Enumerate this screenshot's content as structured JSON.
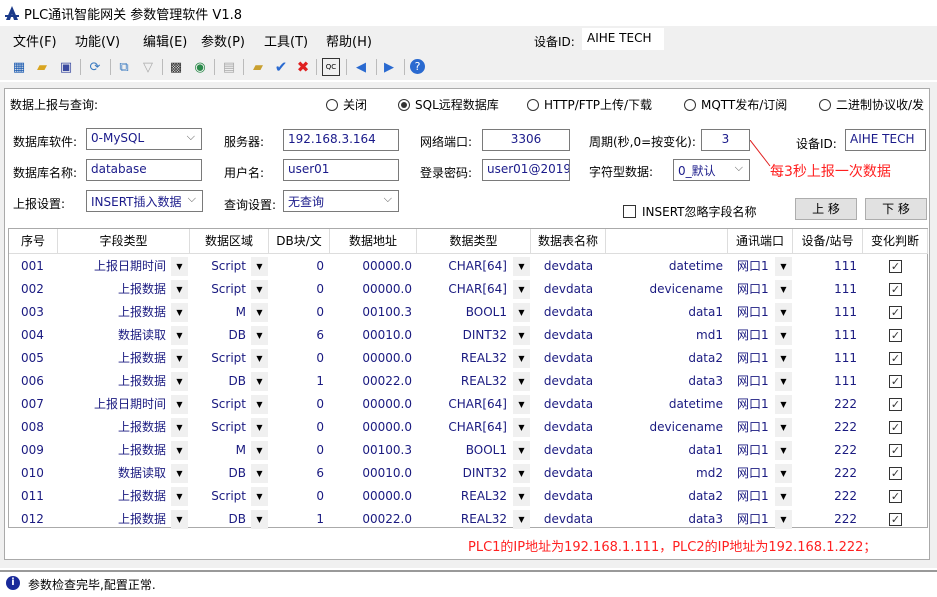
{
  "app": {
    "title": "PLC通讯智能网关 参数管理软件 V1.8"
  },
  "menu": [
    "文件(F)",
    "功能(V)",
    "编辑(E)",
    "参数(P)",
    "工具(T)",
    "帮助(H)"
  ],
  "header_device": {
    "label": "设备ID:",
    "value": "AIHE TECH"
  },
  "toolbar": [
    "network-icon",
    "open-folder-icon",
    "save-icon",
    "refresh-icon",
    "topology-icon",
    "connector-icon",
    "monitor-icon",
    "web-icon",
    "table-icon",
    "import-icon",
    "check-icon",
    "delete-icon",
    "qc-icon",
    "prev-icon",
    "next-icon",
    "help-icon"
  ],
  "report": {
    "label": "数据上报与查询:",
    "options": [
      "关闭",
      "SQL远程数据库",
      "HTTP/FTP上传/下载",
      "MQTT发布/订阅",
      "二进制协议收/发"
    ],
    "selected": 1
  },
  "form": {
    "db_software": {
      "label": "数据库软件:",
      "value": "0-MySQL"
    },
    "server": {
      "label": "服务器:",
      "value": "192.168.3.164"
    },
    "port": {
      "label": "网络端口:",
      "value": "3306"
    },
    "period": {
      "label": "周期(秒,0=按变化):",
      "value": "3"
    },
    "device_id": {
      "label": "设备ID:",
      "value": "AIHE TECH"
    },
    "db_name": {
      "label": "数据库名称:",
      "value": "database"
    },
    "username": {
      "label": "用户名:",
      "value": "user01"
    },
    "password": {
      "label": "登录密码:",
      "value": "user01@2019("
    },
    "string_data": {
      "label": "字符型数据:",
      "value": "0_默认"
    },
    "report_setting": {
      "label": "上报设置:",
      "value": "INSERT插入数据"
    },
    "query_setting": {
      "label": "查询设置:",
      "value": "无查询"
    },
    "insert_ignore": {
      "label": "INSERT忽略字段名称",
      "checked": false
    },
    "move_up": "上 移",
    "move_down": "下 移"
  },
  "annotations": {
    "period_note": "每3秒上报一次数据",
    "ip_note": "PLC1的IP地址为192.168.1.111，PLC2的IP地址为192.168.1.222；",
    "color": "#ff0000"
  },
  "table": {
    "columns": [
      "序号",
      "字段类型",
      "数据区域",
      "DB块/文",
      "数据地址",
      "数据类型",
      "数据表名称",
      "",
      "通讯端口",
      "设备/站号",
      "变化判断"
    ],
    "rows": [
      [
        "001",
        "上报日期时间",
        "Script",
        "0",
        "00000.0",
        "CHAR[64]",
        "devdata",
        "datetime",
        "网口1",
        "111",
        true
      ],
      [
        "002",
        "上报数据",
        "Script",
        "0",
        "00000.0",
        "CHAR[64]",
        "devdata",
        "devicename",
        "网口1",
        "111",
        true
      ],
      [
        "003",
        "上报数据",
        "M",
        "0",
        "00100.3",
        "BOOL1",
        "devdata",
        "data1",
        "网口1",
        "111",
        true
      ],
      [
        "004",
        "数据读取",
        "DB",
        "6",
        "00010.0",
        "DINT32",
        "devdata",
        "md1",
        "网口1",
        "111",
        true
      ],
      [
        "005",
        "上报数据",
        "Script",
        "0",
        "00000.0",
        "REAL32",
        "devdata",
        "data2",
        "网口1",
        "111",
        true
      ],
      [
        "006",
        "上报数据",
        "DB",
        "1",
        "00022.0",
        "REAL32",
        "devdata",
        "data3",
        "网口1",
        "111",
        true
      ],
      [
        "007",
        "上报日期时间",
        "Script",
        "0",
        "00000.0",
        "CHAR[64]",
        "devdata",
        "datetime",
        "网口1",
        "222",
        true
      ],
      [
        "008",
        "上报数据",
        "Script",
        "0",
        "00000.0",
        "CHAR[64]",
        "devdata",
        "devicename",
        "网口1",
        "222",
        true
      ],
      [
        "009",
        "上报数据",
        "M",
        "0",
        "00100.3",
        "BOOL1",
        "devdata",
        "data1",
        "网口1",
        "222",
        true
      ],
      [
        "010",
        "数据读取",
        "DB",
        "6",
        "00010.0",
        "DINT32",
        "devdata",
        "md2",
        "网口1",
        "222",
        true
      ],
      [
        "011",
        "上报数据",
        "Script",
        "0",
        "00000.0",
        "REAL32",
        "devdata",
        "data2",
        "网口1",
        "222",
        true
      ],
      [
        "012",
        "上报数据",
        "DB",
        "1",
        "00022.0",
        "REAL32",
        "devdata",
        "data3",
        "网口1",
        "222",
        true
      ]
    ]
  },
  "status": {
    "icon": "info-icon",
    "text": "参数检查完毕,配置正常."
  }
}
